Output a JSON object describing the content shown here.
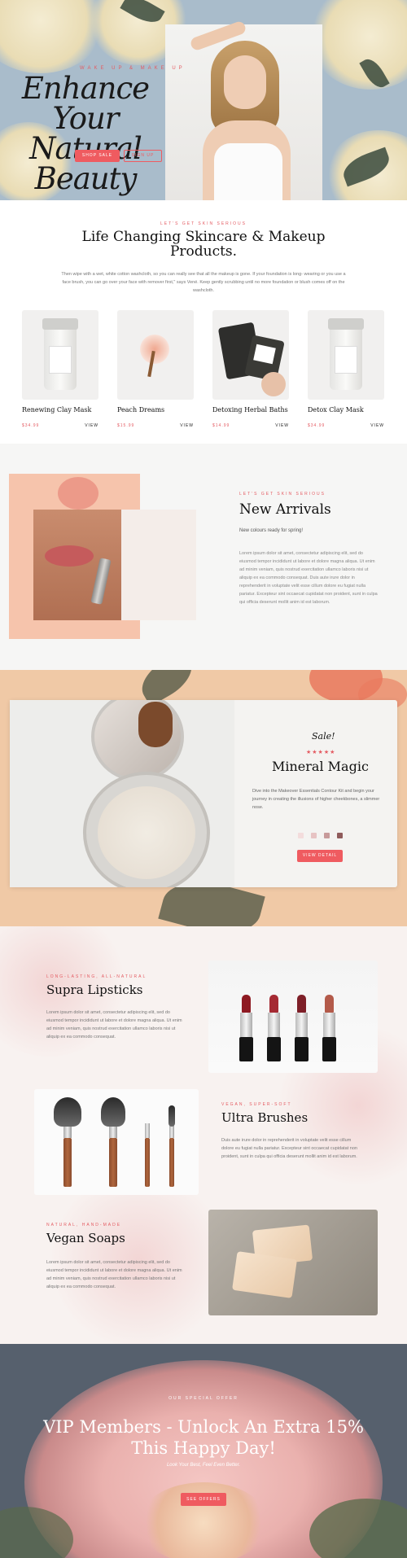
{
  "hero": {
    "kicker": "WAKE UP & MAKE UP",
    "title_line1": "Enhance Your",
    "title_line2": "Natural Beauty",
    "shop_button": "SHOP SALE",
    "sign_button": "SIGN UP"
  },
  "intro": {
    "kicker": "LET'S GET SKIN SERIOUS",
    "title": "Life Changing Skincare & Makeup Products.",
    "text": "Then wipe with a wet, white cotton washcloth, so you can really see that all the makeup is gone. If your foundation is long- wearing or you use a face brush, you can go over your face with remover first,\" says Vené. Keep gently scrubbing until no more foundation or blush comes off on the washcloth.",
    "products": [
      {
        "name": "Renewing Clay Mask",
        "price": "$34.99",
        "view": "VIEW"
      },
      {
        "name": "Peach Dreams",
        "price": "$15.99",
        "view": "VIEW"
      },
      {
        "name": "Detoxing Herbal Baths",
        "price": "$14.99",
        "view": "VIEW"
      },
      {
        "name": "Detox Clay Mask",
        "price": "$34.99",
        "view": "VIEW"
      }
    ]
  },
  "arrivals": {
    "kicker": "LET'S GET SKIN SERIOUS",
    "title": "New Arrivals",
    "subtitle": "New colours ready for spring!",
    "text": "Lorem ipsum dolor sit amet, consectetur adipiscing elit, sed do eiusmod tempor incididunt ut labore et dolore magna aliqua. Ut enim ad minim veniam, quis nostrud exercitation ullamco laboris nisi ut aliquip ex ea commodo consequat. Duis aute irure dolor in reprehenderit in voluptate velit esse cillum dolore eu fugiat nulla pariatur. Excepteur sint occaecat cupidatat non proident, sunt in culpa qui officia deserunt mollit anim id est laborum."
  },
  "mineral": {
    "sale": "Sale!",
    "stars": "★★★★★",
    "rating": 5,
    "title": "Mineral Magic",
    "text": "Dive into the Makeover Essentials Contour Kit and begin your journey in creating the illusions of higher cheekbones, a slimmer nose.",
    "button": "VIEW DETAIL",
    "swatches": [
      "#f3dcdc",
      "#e7c3c3",
      "#c79a9a",
      "#8f5b5b"
    ]
  },
  "features": [
    {
      "kicker": "LONG-LASTING, ALL-NATURAL",
      "title": "Supra Lipsticks",
      "text": "Lorem ipsum dolor sit amet, consectetur adipiscing elit, sed do eiusmod tempor incididunt ut labore et dolore magna aliqua. Ut enim ad minim veniam, quis nostrud exercitation ullamco laboris nisi ut aliquip ex ea commodo consequat."
    },
    {
      "kicker": "VEGAN, SUPER-SOFT",
      "title": "Ultra Brushes",
      "text": "Duis aute irure dolor in reprehenderit in voluptate velit esse cillum dolore eu fugiat nulla pariatur. Excepteur sint occaecat cupidatat non proident, sunt in culpa qui officia deserunt mollit anim id est laborum."
    },
    {
      "kicker": "NATURAL, HAND-MADE",
      "title": "Vegan Soaps",
      "text": "Lorem ipsum dolor sit amet, consectetur adipiscing elit, sed do eiusmod tempor incididunt ut labore et dolore magna aliqua. Ut enim ad minim veniam, quis nostrud exercitation ullamco laboris nisi ut aliquip ex ea commodo consequat."
    }
  ],
  "vip": {
    "kicker": "OUR SPECIAL OFFER",
    "title": "VIP Members - Unlock An Extra 15% This Happy Day!",
    "subtitle": "Look Your Best, Feel Even Better.",
    "button": "SEE OFFERS"
  },
  "colors": {
    "accent": "#ef5b60",
    "hero_bg": "#a9bccb",
    "arrivals_card": "#f6c4ac",
    "mineral_bg": "#f0c9a6",
    "vip_bg": "#56606d"
  }
}
